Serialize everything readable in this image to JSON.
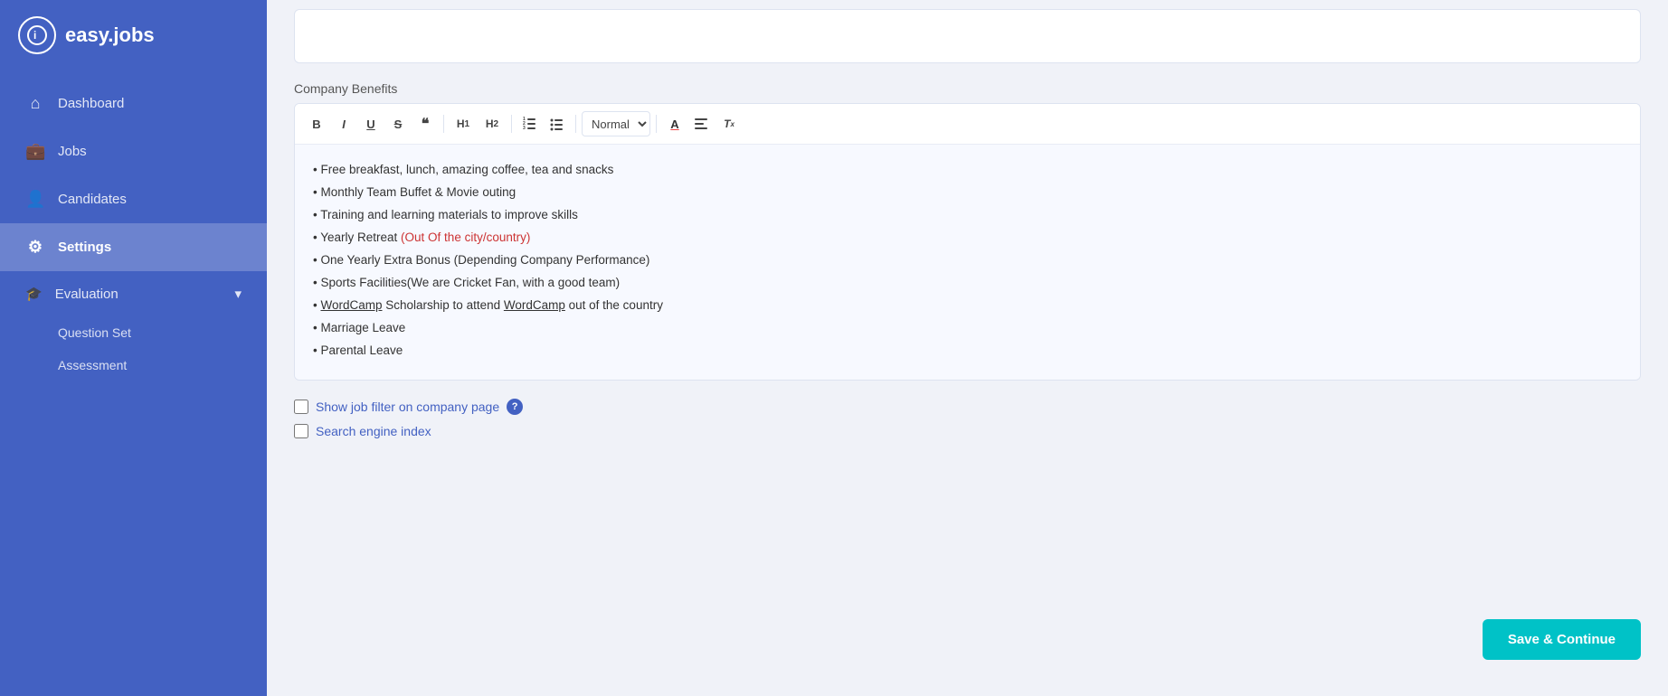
{
  "app": {
    "name": "easy.jobs"
  },
  "sidebar": {
    "items": [
      {
        "id": "dashboard",
        "label": "Dashboard",
        "icon": "⌂"
      },
      {
        "id": "jobs",
        "label": "Jobs",
        "icon": "💼"
      },
      {
        "id": "candidates",
        "label": "Candidates",
        "icon": "👤"
      },
      {
        "id": "settings",
        "label": "Settings",
        "icon": "⚙",
        "active": true
      },
      {
        "id": "evaluation",
        "label": "Evaluation",
        "icon": "🎓"
      }
    ],
    "evaluation_sub": [
      {
        "id": "question-set",
        "label": "Question Set"
      },
      {
        "id": "assessment",
        "label": "Assessment"
      }
    ]
  },
  "main": {
    "company_benefits_label": "Company Benefits",
    "toolbar": {
      "bold": "B",
      "italic": "I",
      "underline": "U",
      "strikethrough": "S",
      "blockquote": "❝",
      "h1": "H1",
      "h2": "H2",
      "ordered_list": "≡",
      "unordered_list": "≡",
      "format_select": "Normal",
      "text_color": "A",
      "align": "≡",
      "clear_format": "Tx"
    },
    "benefits": [
      "Free breakfast, lunch, amazing coffee, tea and snacks",
      "Monthly Team Buffet & Movie outing",
      "Training and learning materials to improve skills",
      "Yearly Retreat (Out Of the city/country)",
      "One Yearly Extra Bonus (Depending Company Performance)",
      "Sports Facilities(We are Cricket Fan, with a good team)",
      "WordCamp Scholarship to attend WordCamp out of the country",
      "Marriage Leave",
      "Parental Leave"
    ],
    "checkboxes": [
      {
        "id": "show-job-filter",
        "label": "Show job filter on company page",
        "has_help": true
      },
      {
        "id": "search-engine-index",
        "label": "Search engine index",
        "has_help": false
      }
    ],
    "save_button_label": "Save & Continue"
  }
}
